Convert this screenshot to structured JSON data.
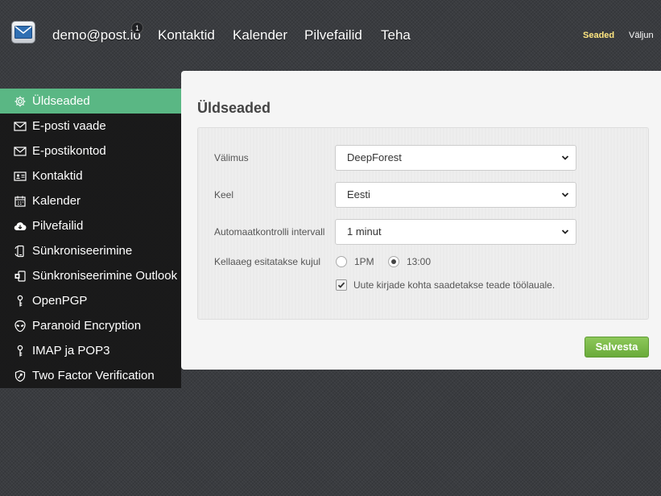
{
  "header": {
    "account": "demo@post.io",
    "badge_count": "1",
    "nav": [
      "Kontaktid",
      "Kalender",
      "Pilvefailid",
      "Teha"
    ],
    "settings": "Seaded",
    "logout": "Väljun"
  },
  "sidebar": {
    "items": [
      {
        "label": "Üldseaded",
        "icon": "gear-icon",
        "active": true
      },
      {
        "label": "E-posti vaade",
        "icon": "envelope-icon"
      },
      {
        "label": "E-postikontod",
        "icon": "envelope-icon"
      },
      {
        "label": "Kontaktid",
        "icon": "contact-card-icon"
      },
      {
        "label": "Kalender",
        "icon": "calendar-icon"
      },
      {
        "label": "Pilvefailid",
        "icon": "cloud-download-icon"
      },
      {
        "label": "Sünkroniseerimine",
        "icon": "sync-phone-icon"
      },
      {
        "label": "Sünkroniseerimine Outlook",
        "icon": "sync-outlook-icon"
      },
      {
        "label": "OpenPGP",
        "icon": "key-icon"
      },
      {
        "label": "Paranoid Encryption",
        "icon": "alien-icon"
      },
      {
        "label": "IMAP ja POP3",
        "icon": "key-icon"
      },
      {
        "label": "Two Factor Verification",
        "icon": "shield-key-icon"
      }
    ]
  },
  "main": {
    "title": "Üldseaded",
    "fields": {
      "appearance": {
        "label": "Välimus",
        "value": "DeepForest"
      },
      "language": {
        "label": "Keel",
        "value": "Eesti"
      },
      "autocheck": {
        "label": "Automaatkontrolli intervall",
        "value": "1 minut"
      },
      "time_format": {
        "label": "Kellaaeg esitatakse kujul",
        "options": [
          "1PM",
          "13:00"
        ],
        "selected": "13:00"
      },
      "desktop_notify": {
        "label": "Uute kirjade kohta saadetakse teade töölauale.",
        "checked": true
      }
    },
    "save": "Salvesta"
  },
  "colors": {
    "accent_active": "#5ab784",
    "save_button": "#7ab94a",
    "settings_link": "#ffe680"
  }
}
